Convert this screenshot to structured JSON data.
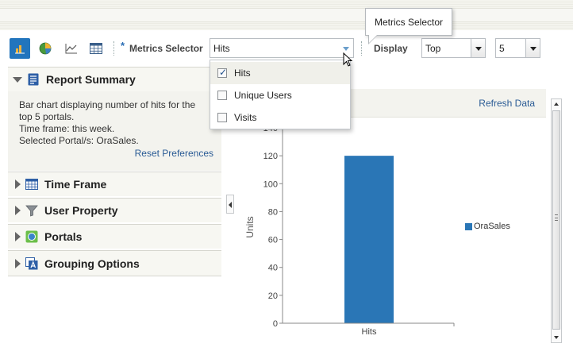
{
  "toolbar": {
    "view_buttons": [
      {
        "name": "bar-chart-icon",
        "active": true
      },
      {
        "name": "pie-chart-icon",
        "active": false
      },
      {
        "name": "line-chart-icon",
        "active": false
      },
      {
        "name": "table-icon",
        "active": false
      }
    ],
    "required_marker": "*",
    "metrics_label": "Metrics Selector",
    "metrics_value": "Hits",
    "display_label": "Display",
    "display_value": "Top",
    "count_value": "5"
  },
  "tooltip": {
    "text": "Metrics Selector"
  },
  "metrics_dropdown": {
    "items": [
      {
        "label": "Hits",
        "checked": true
      },
      {
        "label": "Unique Users",
        "checked": false
      },
      {
        "label": "Visits",
        "checked": false
      }
    ]
  },
  "sidebar": {
    "report_summary": {
      "title": "Report Summary",
      "lines": [
        "Bar chart displaying number of hits for the",
        "top 5 portals.",
        "Time frame: this week.",
        "Selected Portal/s: OraSales."
      ],
      "reset_label": "Reset Preferences"
    },
    "sections": [
      {
        "title": "Time Frame",
        "icon": "calendar-icon"
      },
      {
        "title": "User Property",
        "icon": "funnel-icon"
      },
      {
        "title": "Portals",
        "icon": "portal-icon"
      },
      {
        "title": "Grouping Options",
        "icon": "grouping-icon"
      }
    ]
  },
  "chart_panel": {
    "refresh_label": "Refresh Data"
  },
  "colors": {
    "accent": "#2275bd",
    "bar": "#2a76b6",
    "link": "#2a5b95"
  },
  "chart_data": {
    "type": "bar",
    "categories": [
      "Hits"
    ],
    "series": [
      {
        "name": "OraSales",
        "values": [
          120
        ]
      }
    ],
    "ylabel": "Units",
    "xlabel": "",
    "ylim": [
      0,
      140
    ],
    "yticks": [
      0,
      20,
      40,
      60,
      80,
      100,
      120,
      140
    ],
    "legend": "right",
    "grid": false
  }
}
